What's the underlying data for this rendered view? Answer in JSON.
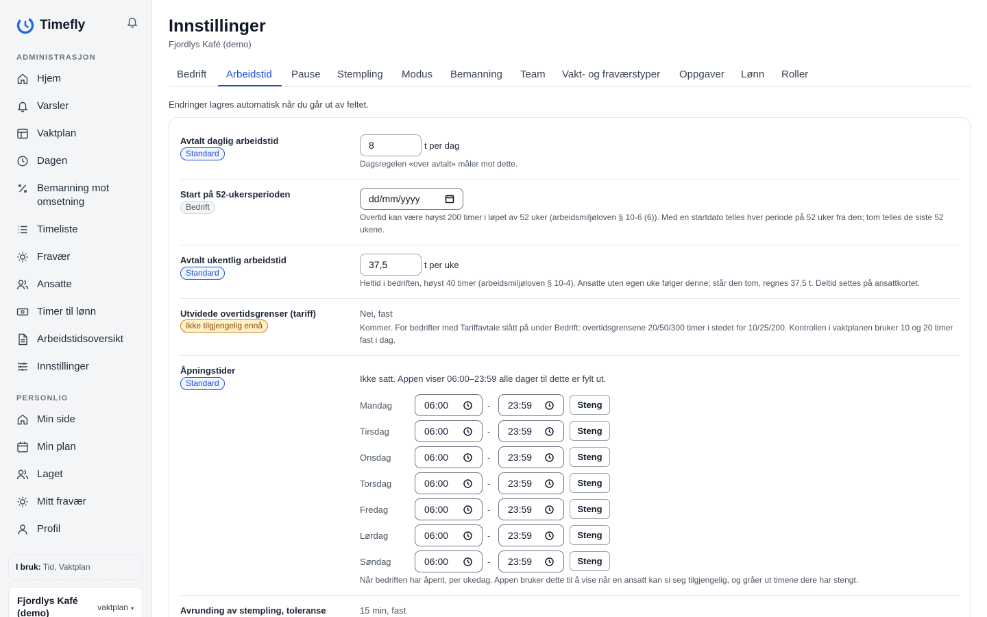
{
  "app": {
    "name": "Timefly"
  },
  "sidebar": {
    "section_admin": "ADMINISTRASJON",
    "admin_items": [
      {
        "label": "Hjem",
        "icon": "home-icon"
      },
      {
        "label": "Varsler",
        "icon": "bell-icon"
      },
      {
        "label": "Vaktplan",
        "icon": "table-icon"
      },
      {
        "label": "Dagen",
        "icon": "clock-icon"
      },
      {
        "label": "Bemanning mot omsetning",
        "icon": "percent-icon"
      },
      {
        "label": "Timeliste",
        "icon": "list-icon"
      },
      {
        "label": "Fravær",
        "icon": "sun-icon"
      },
      {
        "label": "Ansatte",
        "icon": "users-icon"
      },
      {
        "label": "Timer til lønn",
        "icon": "banknote-icon"
      },
      {
        "label": "Arbeidstidsoversikt",
        "icon": "document-icon"
      },
      {
        "label": "Innstillinger",
        "icon": "sliders-icon"
      }
    ],
    "section_personal": "PERSONLIG",
    "personal_items": [
      {
        "label": "Min side",
        "icon": "home-icon"
      },
      {
        "label": "Min plan",
        "icon": "calendar-icon"
      },
      {
        "label": "Laget",
        "icon": "users-icon"
      },
      {
        "label": "Mitt fravær",
        "icon": "sun-icon"
      },
      {
        "label": "Profil",
        "icon": "user-icon"
      }
    ],
    "in_use_label": "I bruk:",
    "in_use_value": "Tid, Vaktplan",
    "company_name": "Fjordlys Kafé (demo)",
    "plan": "vaktplan",
    "plan_caret": "▾"
  },
  "page": {
    "title": "Innstillinger",
    "subtitle": "Fjordlys Kafé (demo)",
    "tabs": [
      "Bedrift",
      "Arbeidstid",
      "Pause",
      "Stempling",
      "Modus",
      "Bemanning",
      "Team",
      "Vakt- og fraværstyper",
      "Oppgaver",
      "Lønn",
      "Roller"
    ],
    "active_tab": "Arbeidstid",
    "autosave_hint": "Endringer lagres automatisk når du går ut av feltet."
  },
  "settings": {
    "daily": {
      "label": "Avtalt daglig arbeidstid",
      "badge": "Standard",
      "value": "8",
      "unit": "t per dag",
      "help": "Dagsregelen «over avtalt» måler mot dette."
    },
    "period": {
      "label": "Start på 52-ukersperioden",
      "badge": "Bedrift",
      "placeholder": "dd/mm/yyyy",
      "help": "Overtid kan være høyst 200 timer i løpet av 52 uker (arbeidsmiljøloven § 10-6 (6)). Med en startdato telles hver periode på 52 uker fra den; tom telles de siste 52 ukene."
    },
    "weekly": {
      "label": "Avtalt ukentlig arbeidstid",
      "badge": "Standard",
      "value": "37,5",
      "unit": "t per uke",
      "help": "Heltid i bedriften, høyst 40 timer (arbeidsmiljøloven § 10-4). Ansatte uten egen uke følger denne; står den tom, regnes 37,5 t. Deltid settes på ansattkortet."
    },
    "overtime": {
      "label": "Utvidede overtidsgrenser (tariff)",
      "badge": "Ikke tilgjengelig ennå",
      "value": "Nei, fast",
      "help": "Kommer. For bedrifter med Tariffavtale slått på under Bedrift: overtidsgrensene 20/50/300 timer i stedet for 10/25/200. Kontrollen i vaktplanen bruker 10 og 20 timer fast i dag."
    },
    "opening": {
      "label": "Åpningstider",
      "badge": "Standard",
      "status": "Ikke satt. Appen viser 06:00–23:59 alle dager til dette er fylt ut.",
      "dash": "-",
      "close_label": "Steng",
      "days": [
        {
          "name": "Mandag",
          "from": "06:00",
          "to": "23:59"
        },
        {
          "name": "Tirsdag",
          "from": "06:00",
          "to": "23:59"
        },
        {
          "name": "Onsdag",
          "from": "06:00",
          "to": "23:59"
        },
        {
          "name": "Torsdag",
          "from": "06:00",
          "to": "23:59"
        },
        {
          "name": "Fredag",
          "from": "06:00",
          "to": "23:59"
        },
        {
          "name": "Lørdag",
          "from": "06:00",
          "to": "23:59"
        },
        {
          "name": "Søndag",
          "from": "06:00",
          "to": "23:59"
        }
      ],
      "help": "Når bedriften har åpent, per ukedag. Appen bruker dette til å vise når en ansatt kan si seg tilgjengelig, og gråer ut timene dere har stengt."
    },
    "rounding": {
      "label": "Avrunding av stempling, toleranse",
      "value": "15 min, fast"
    }
  },
  "colors": {
    "accent": "#1d4ed8",
    "warning": "#d97706"
  }
}
